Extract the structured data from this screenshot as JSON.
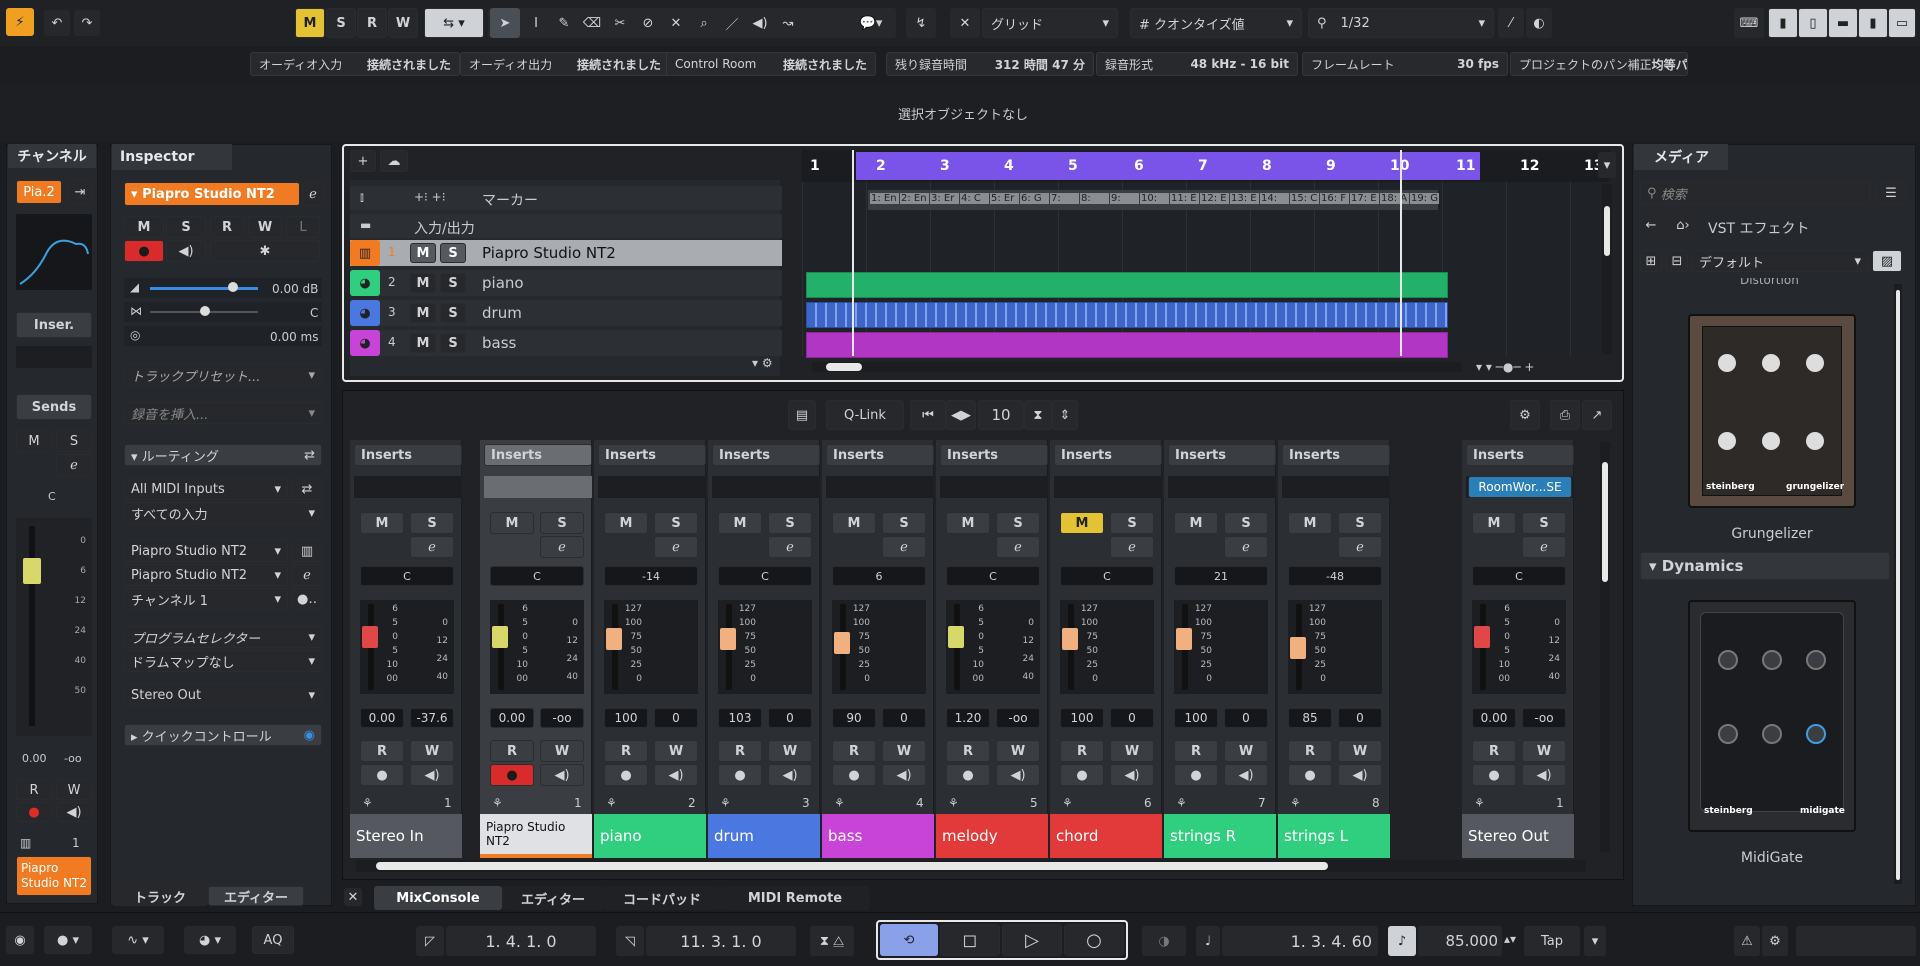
{
  "toolbar": {
    "msrw": [
      "M",
      "S",
      "R",
      "W"
    ],
    "grid_label": "グリッド",
    "quantize_label": "クオンタイズ値",
    "quantize_value": "1/32"
  },
  "status": [
    {
      "label": "オーディオ入力",
      "value": "接続されました"
    },
    {
      "label": "オーディオ出力",
      "value": "接続されました"
    },
    {
      "label": "Control Room",
      "value": "接続されました"
    },
    {
      "label": "残り録音時間",
      "value": "312 時間 47 分"
    },
    {
      "label": "録音形式",
      "value": "48 kHz - 16 bit"
    },
    {
      "label": "フレームレート",
      "value": "30 fps"
    },
    {
      "label": "プロジェクトのパン補正",
      "value": "均等パワー"
    }
  ],
  "info_line": "選択オブジェクトなし",
  "channel_panel": {
    "title": "チャンネル",
    "track": "Pia.2",
    "inserts": "Inser.",
    "sends": "Sends",
    "m": "M",
    "s": "S",
    "r": "R",
    "w": "W",
    "pan": "C",
    "vol": "0.00",
    "vol2": "-oo",
    "num": "1",
    "name": "Piapro Studio NT2"
  },
  "inspector": {
    "tab": "Inspector",
    "track": "Piapro Studio NT2",
    "m": "M",
    "s": "S",
    "r": "R",
    "w": "W",
    "l": "L",
    "volume": "0.00 dB",
    "pan": "C",
    "delay": "0.00 ms",
    "preset": "トラックプリセット...",
    "insert_recording": "録音を挿入...",
    "routing": "ルーティング",
    "midi_in": "All MIDI Inputs",
    "all_in": "すべての入力",
    "out1": "Piapro Studio NT2",
    "out2": "Piapro Studio NT2",
    "channel": "チャンネル 1",
    "prog_sel": "プログラムセレクター",
    "drum_map": "ドラムマップなし",
    "stereo_out": "Stereo Out",
    "quick": "クイックコントロール",
    "bottom_tabs": [
      "トラック",
      "エディター"
    ]
  },
  "tracks": [
    {
      "name": "マーカー"
    },
    {
      "name": "入力/出力"
    },
    {
      "num": "1",
      "name": "Piapro Studio NT2",
      "color": "#f07b22"
    },
    {
      "num": "2",
      "name": "piano",
      "color": "#2fcf7f"
    },
    {
      "num": "3",
      "name": "drum",
      "color": "#4a78e0"
    },
    {
      "num": "4",
      "name": "bass",
      "color": "#c844d8"
    }
  ],
  "ruler": [
    "1",
    "2",
    "3",
    "4",
    "5",
    "6",
    "7",
    "8",
    "9",
    "10",
    "11",
    "12",
    "13"
  ],
  "markers": [
    "1: En",
    "2: En",
    "3: Er",
    "4: C",
    "5: Er",
    "6: G",
    "7:",
    "8:",
    "9:",
    "10:",
    "11: E",
    "12: E",
    "13: E",
    "14:",
    "15: C",
    "16: F",
    "17: E",
    "18: A",
    "19: G"
  ],
  "mix_toolbar": {
    "qlink": "Q-Link",
    "count": "10"
  },
  "mixer": [
    {
      "label": "Inserts",
      "m": "M",
      "s": "S",
      "pan": "C",
      "v1": "0.00",
      "v2": "-37.6",
      "num": "1",
      "name": "Stereo In",
      "color": "#2b2e33",
      "scale": [
        "6",
        "5",
        "0",
        "5",
        "10",
        "00"
      ],
      "scale2": [
        "0",
        "12",
        "24",
        "40"
      ]
    },
    {
      "label": "Inserts",
      "m": "M",
      "s": "S",
      "pan": "C",
      "v1": "0.00",
      "v2": "-oo",
      "num": "1",
      "name": "Piapro Studio NT2",
      "color": "#f07b22",
      "scale": [
        "6",
        "5",
        "0",
        "5",
        "10",
        "00"
      ],
      "scale2": [
        "0",
        "12",
        "24",
        "40"
      ]
    },
    {
      "label": "Inserts",
      "m": "M",
      "s": "S",
      "pan": "-14",
      "v1": "100",
      "v2": "0",
      "num": "2",
      "name": "piano",
      "color": "#2fcf7f",
      "scale": [
        "127",
        "100",
        "75",
        "50",
        "25",
        "0"
      ]
    },
    {
      "label": "Inserts",
      "m": "M",
      "s": "S",
      "pan": "C",
      "v1": "103",
      "v2": "0",
      "num": "3",
      "name": "drum",
      "color": "#4a78e0",
      "scale": [
        "127",
        "100",
        "75",
        "50",
        "25",
        "0"
      ]
    },
    {
      "label": "Inserts",
      "m": "M",
      "s": "S",
      "pan": "6",
      "v1": "90",
      "v2": "0",
      "num": "4",
      "name": "bass",
      "color": "#c844d8",
      "scale": [
        "127",
        "100",
        "75",
        "50",
        "25",
        "0"
      ]
    },
    {
      "label": "Inserts",
      "m": "M",
      "s": "S",
      "pan": "C",
      "v1": "1.20",
      "v2": "-oo",
      "num": "5",
      "name": "melody",
      "color": "#e23a3a",
      "scale": [
        "6",
        "5",
        "0",
        "5",
        "10",
        "00"
      ],
      "scale2": [
        "0",
        "12",
        "24",
        "40"
      ]
    },
    {
      "label": "Inserts",
      "m": "M",
      "s": "S",
      "pan": "C",
      "v1": "100",
      "v2": "0",
      "num": "6",
      "name": "chord",
      "color": "#e23a3a",
      "scale": [
        "127",
        "100",
        "75",
        "50",
        "25",
        "0"
      ]
    },
    {
      "label": "Inserts",
      "m": "M",
      "s": "S",
      "pan": "21",
      "v1": "100",
      "v2": "0",
      "num": "7",
      "name": "strings R",
      "color": "#2fcf7f",
      "scale": [
        "127",
        "100",
        "75",
        "50",
        "25",
        "0"
      ]
    },
    {
      "label": "Inserts",
      "m": "M",
      "s": "S",
      "pan": "-48",
      "v1": "85",
      "v2": "0",
      "num": "8",
      "name": "strings L",
      "color": "#2fcf7f",
      "scale": [
        "127",
        "100",
        "75",
        "50",
        "25",
        "0"
      ]
    },
    {
      "label": "Inserts",
      "m": "M",
      "s": "S",
      "pan": "C",
      "v1": "0.00",
      "v2": "-oo",
      "num": "1",
      "name": "Stereo Out",
      "color": "#2b2e33",
      "scale": [
        "6",
        "5",
        "0",
        "5",
        "10",
        "00"
      ],
      "scale2": [
        "0",
        "12",
        "24",
        "40"
      ],
      "insert": "RoomWor...SE"
    }
  ],
  "lower_tabs": [
    "MixConsole",
    "エディター",
    "コードパッド",
    "MIDI Remote"
  ],
  "media": {
    "tab": "メディア",
    "search": "検索",
    "path": "VST エフェクト",
    "preset": "デフォルト",
    "partial": "Distortion",
    "plugin1": "Grungelizer",
    "section": "Dynamics",
    "plugin2": "MidiGate",
    "brand": "steinberg",
    "brand1": "grungelizer",
    "brand2": "midigate"
  },
  "transport": {
    "left": "1. 4. 1.   0",
    "right": "11. 3. 1.   0",
    "pos": "1. 3. 4. 60",
    "tempo": "85.000",
    "tap": "Tap",
    "aq": "AQ"
  }
}
